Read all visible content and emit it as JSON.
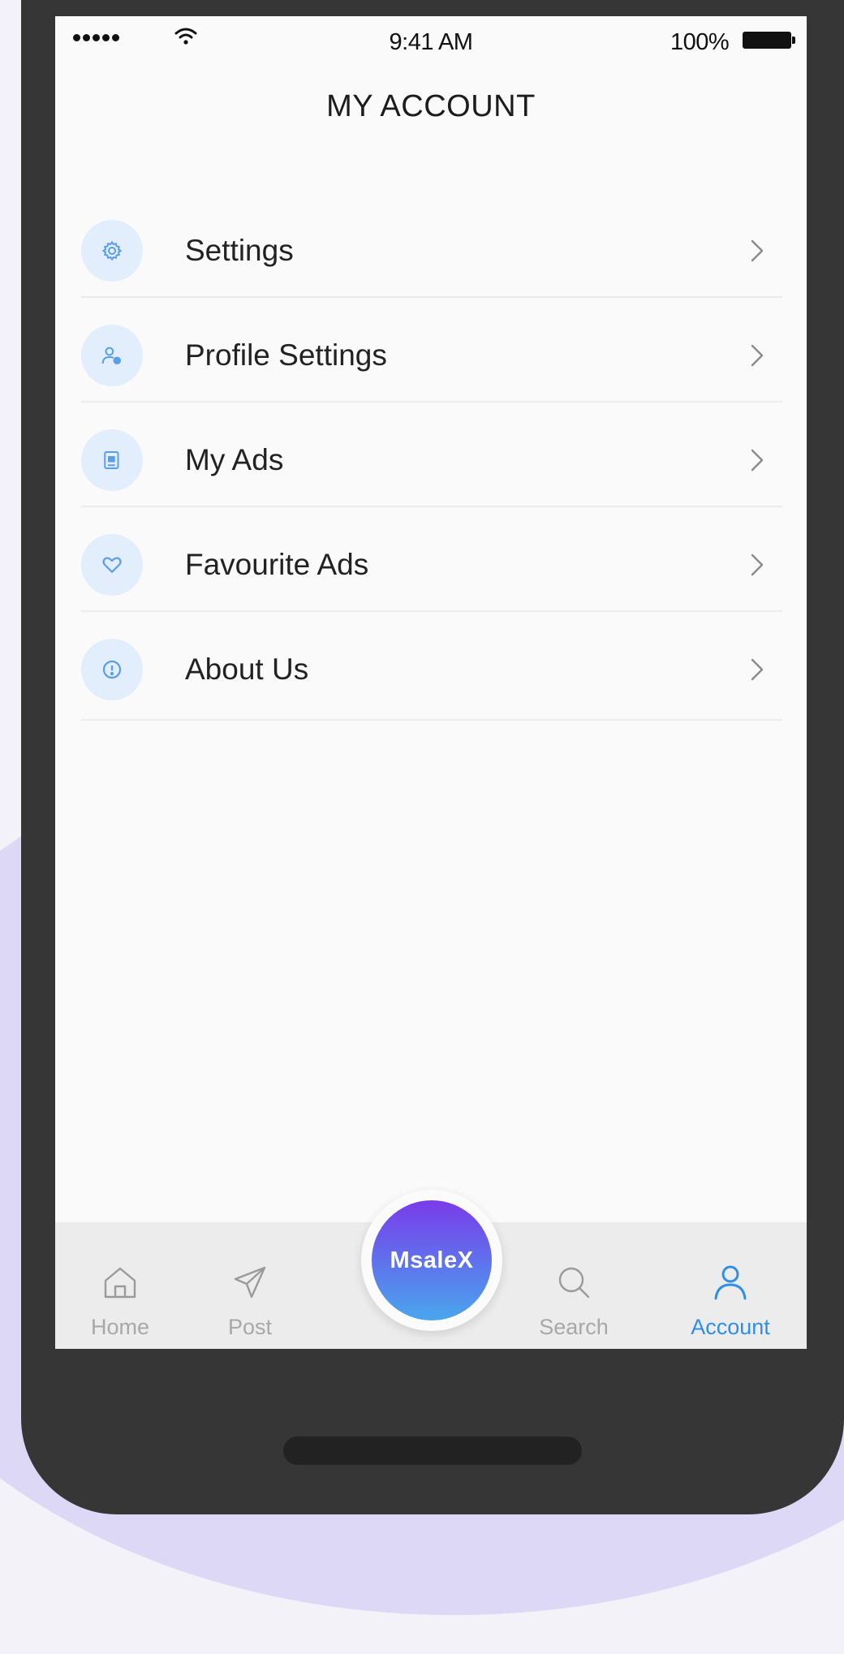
{
  "status_bar": {
    "time": "9:41 AM",
    "battery": "100%"
  },
  "header": {
    "title": "MY ACCOUNT"
  },
  "menu": {
    "items": [
      {
        "label": "Settings",
        "icon": "gear-icon"
      },
      {
        "label": "Profile Settings",
        "icon": "user-settings-icon"
      },
      {
        "label": "My Ads",
        "icon": "ads-icon"
      },
      {
        "label": "Favourite Ads",
        "icon": "heart-icon"
      },
      {
        "label": "About Us",
        "icon": "info-icon"
      }
    ]
  },
  "tabbar": {
    "home": "Home",
    "post": "Post",
    "center": "MsaleX",
    "search": "Search",
    "account": "Account",
    "active": "account"
  },
  "colors": {
    "accent": "#2f8fe6",
    "icon_bg": "#e2eefc",
    "phone_frame": "#363636",
    "center_gradient_top": "#7a3bea",
    "center_gradient_bottom": "#4aa6ee"
  }
}
